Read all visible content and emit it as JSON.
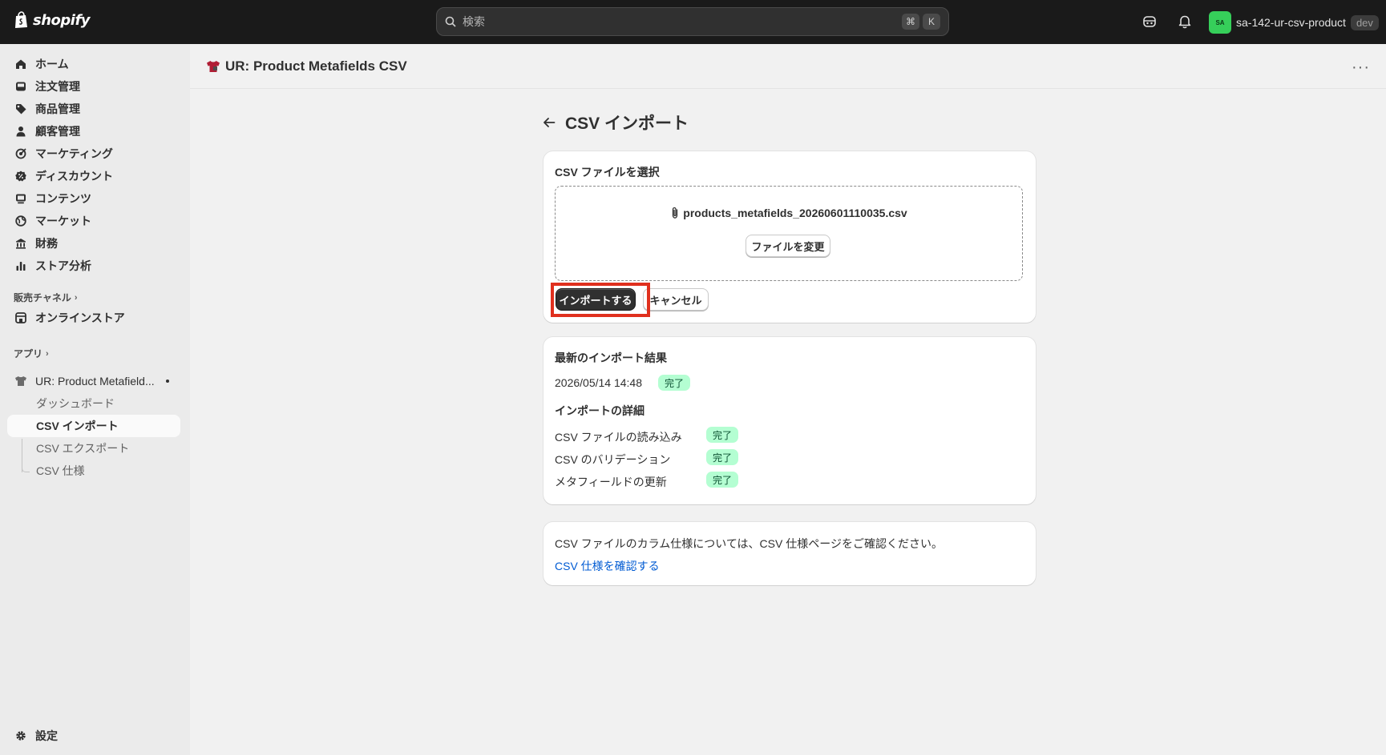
{
  "topbar": {
    "logo_text": "shopify",
    "search_placeholder": "検索",
    "shortcut_keys": [
      "⌘",
      "K"
    ],
    "store_avatar": "SA",
    "store_name": "sa-142-ur-csv-product",
    "store_badge": "dev"
  },
  "sidebar": {
    "items": [
      {
        "label": "ホーム",
        "icon": "home-icon"
      },
      {
        "label": "注文管理",
        "icon": "inbox-icon"
      },
      {
        "label": "商品管理",
        "icon": "tag-icon"
      },
      {
        "label": "顧客管理",
        "icon": "person-icon"
      },
      {
        "label": "マーケティング",
        "icon": "target-icon"
      },
      {
        "label": "ディスカウント",
        "icon": "discount-icon"
      },
      {
        "label": "コンテンツ",
        "icon": "content-icon"
      },
      {
        "label": "マーケット",
        "icon": "globe-icon"
      },
      {
        "label": "財務",
        "icon": "bank-icon"
      },
      {
        "label": "ストア分析",
        "icon": "chart-icon"
      }
    ],
    "sales_channels_label": "販売チャネル",
    "online_store_label": "オンラインストア",
    "apps_label": "アプリ",
    "app_name": "UR: Product Metafield...",
    "app_subitems": [
      "ダッシュボード",
      "CSV インポート",
      "CSV エクスポート",
      "CSV 仕様"
    ],
    "settings_label": "設定"
  },
  "app_header": {
    "title": "UR: Product Metafields CSV"
  },
  "page": {
    "title": "CSV インポート",
    "select_card": {
      "heading": "CSV ファイルを選択",
      "file_name": "products_metafields_20260601110035.csv",
      "change_file_label": "ファイルを変更",
      "import_label": "インポートする",
      "cancel_label": "キャンセル"
    },
    "result_card": {
      "heading": "最新のインポート結果",
      "timestamp": "2026/05/14 14:48",
      "status": "完了",
      "details_heading": "インポートの詳細",
      "details": [
        {
          "label": "CSV ファイルの読み込み",
          "status": "完了"
        },
        {
          "label": "CSV のバリデーション",
          "status": "完了"
        },
        {
          "label": "メタフィールドの更新",
          "status": "完了"
        }
      ]
    },
    "info_card": {
      "text": "CSV ファイルのカラム仕様については、CSV 仕様ページをご確認ください。",
      "link_label": "CSV 仕様を確認する"
    }
  },
  "colors": {
    "topbar": "#1a1a1a",
    "primary_button": "#303030",
    "success_badge": "#b4fed2",
    "link": "#005bd3",
    "highlight": "#e0301e"
  }
}
